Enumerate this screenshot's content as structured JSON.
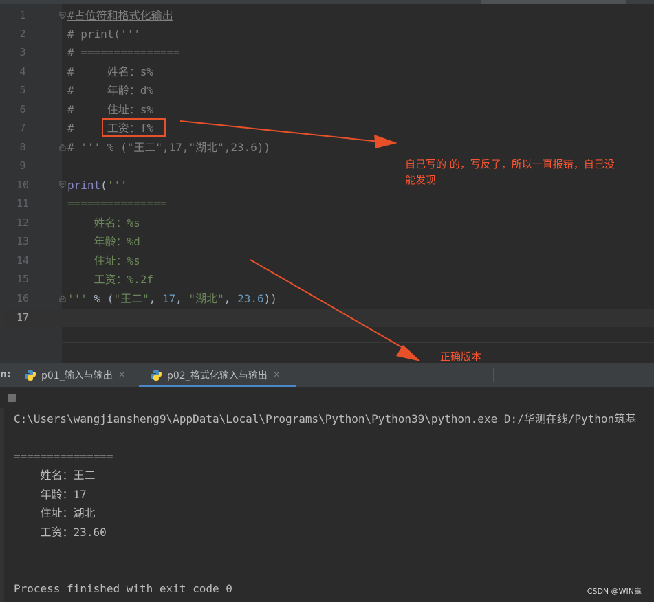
{
  "editor": {
    "line_numbers": [
      "1",
      "2",
      "3",
      "4",
      "5",
      "6",
      "7",
      "8",
      "9",
      "10",
      "11",
      "12",
      "13",
      "14",
      "15",
      "16",
      "17"
    ],
    "active_line": "17",
    "lines": {
      "l1": "#占位符和格式化输出",
      "l2": "# print('''",
      "l3": "# ===============",
      "l4": "#     姓名：s%",
      "l5": "#     年龄：d%",
      "l6": "#     住址：s%",
      "l7": "#     工资：f%",
      "l8": "# ''' % (\"王二\",17,\"湖北\",23.6))",
      "l10_fn": "print",
      "l10_paren": "(",
      "l10_str": "'''",
      "l11": "===============",
      "l12": "    姓名：%s",
      "l13": "    年龄：%d",
      "l14": "    住址：%s",
      "l15": "    工资：%.2f",
      "l16_str": "'''",
      "l16_op": " % (",
      "l16_s1": "\"王二\"",
      "l16_c1": ", ",
      "l16_n1": "17",
      "l16_c2": ", ",
      "l16_s2": "\"湖北\"",
      "l16_c3": ", ",
      "l16_n2": "23.6",
      "l16_end": "))"
    }
  },
  "annotations": {
    "note1_line1": "自己写的 的，写反了，所以一直报错，自己没",
    "note1_line2": "能发现",
    "note2": "正确版本"
  },
  "run_panel": {
    "label": "n:",
    "tabs": [
      {
        "label": "p01_输入与输出",
        "active": false
      },
      {
        "label": "p02_格式化输入与输出",
        "active": true
      }
    ],
    "close_glyph": "×"
  },
  "console": {
    "command": "C:\\Users\\wangjiansheng9\\AppData\\Local\\Programs\\Python\\Python39\\python.exe D:/华测在线/Python筑基",
    "out1": "===============",
    "out2": "    姓名：王二",
    "out3": "    年龄：17",
    "out4": "    住址：湖北",
    "out5": "    工资：23.60",
    "exit": "Process finished with exit code 0"
  },
  "watermark": "CSDN @WIN赢",
  "colors": {
    "annotation": "#fc5531",
    "background": "#2b2b2b",
    "tab_underline": "#4a88c7"
  }
}
